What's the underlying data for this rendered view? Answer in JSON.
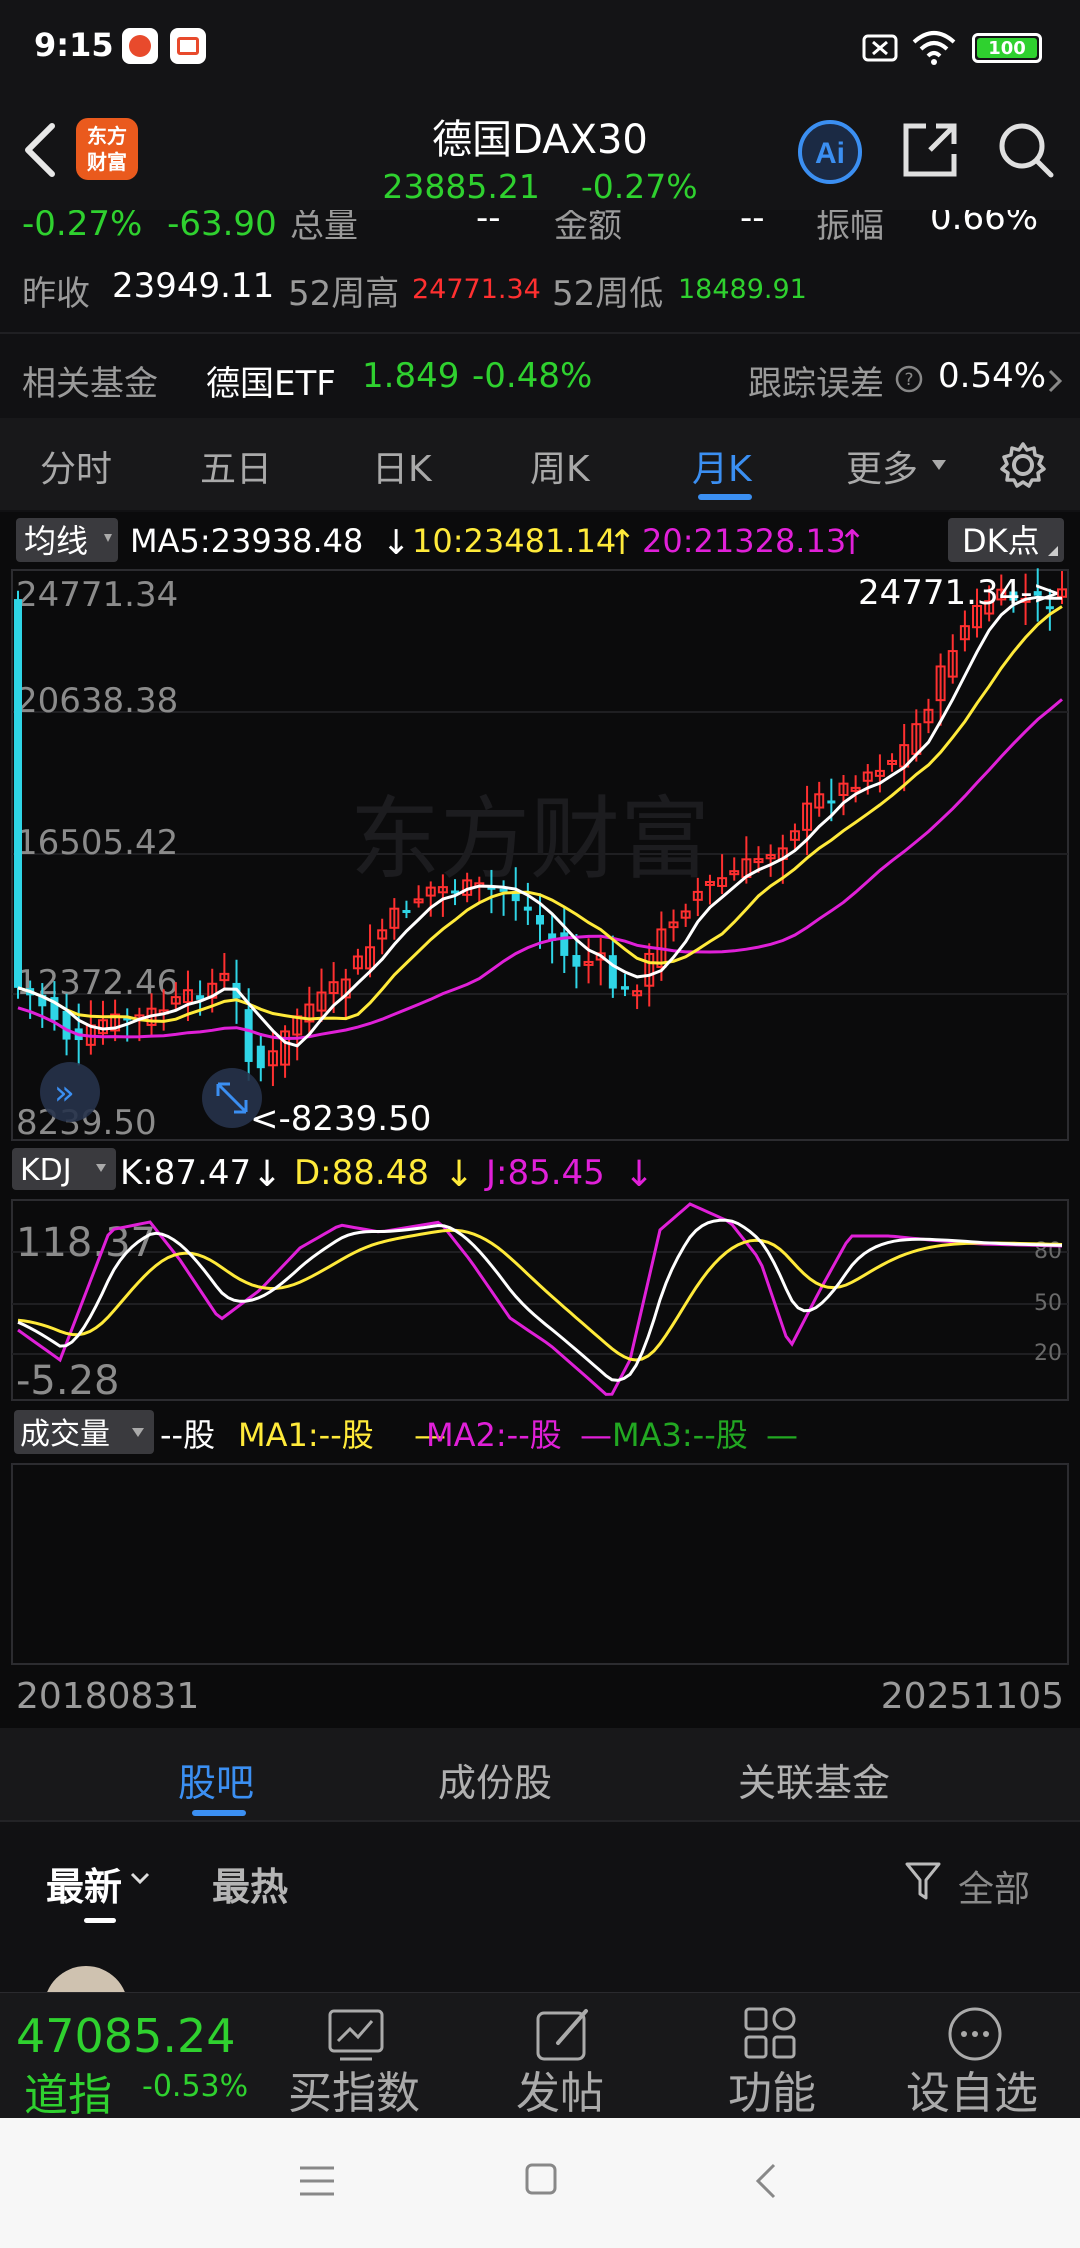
{
  "status": {
    "time": "9:15",
    "battery": "100"
  },
  "header": {
    "title": "德国DAX30",
    "price": "23885.21",
    "change_pct": "-0.27%",
    "logo_text_1": "东方",
    "logo_text_2": "财富"
  },
  "quote": {
    "change_pct": "-0.27%",
    "change_val": "-63.90",
    "volume_label": "总量",
    "volume_value": "--",
    "amount_label": "金额",
    "amount_value": "--",
    "amplitude_label": "振幅",
    "amplitude_value": "0.66%",
    "prev_close_label": "昨收",
    "prev_close": "23949.11",
    "high52_label": "52周高",
    "high52": "24771.34",
    "low52_label": "52周低",
    "low52": "18489.91"
  },
  "fund": {
    "label": "相关基金",
    "name": "德国ETF",
    "price": "1.849",
    "change": "-0.48%",
    "tracking_label": "跟踪误差",
    "tracking_value": "0.54%"
  },
  "kline_tabs": [
    "分时",
    "五日",
    "日K",
    "周K",
    "月K",
    "更多"
  ],
  "ma_bar": {
    "badge": "均线",
    "ma5": "MA5:23938.48",
    "ma10": "10:23481.14",
    "ma20": "20:21328.13",
    "dk": "DK点"
  },
  "main_chart": {
    "y_labels": [
      "24771.34",
      "20638.38",
      "16505.42",
      "12372.46",
      "8239.50"
    ],
    "max_marker": "24771.34->",
    "min_marker": "<-8239.50",
    "watermark": "东方财富"
  },
  "kdj": {
    "badge": "KDJ",
    "k": "K:87.47",
    "d": "D:88.48",
    "j": "J:85.45",
    "y_top": "118.37",
    "y_bottom": "-5.28",
    "levels": [
      "80",
      "50",
      "20"
    ]
  },
  "volume_panel": {
    "badge": "成交量",
    "value": "--股",
    "ma1": "MA1:--股",
    "ma2": "MA2:--股",
    "ma3": "MA3:--股"
  },
  "dates": {
    "start": "20180831",
    "end": "20251105"
  },
  "sub_tabs": [
    "股吧",
    "成份股",
    "关联基金"
  ],
  "feed_tabs": {
    "latest": "最新",
    "hot": "最热",
    "filter": "全部"
  },
  "bottom": {
    "index_value": "47085.24",
    "index_name": "道指",
    "index_change": "-0.53%",
    "tools": [
      "买指数",
      "发帖",
      "功能",
      "设自选"
    ]
  },
  "colors": {
    "accent": "#3b8ff2",
    "up": "#ff3030",
    "down": "#2fd12f",
    "ma5": "#ffffff",
    "ma10": "#ffea3a",
    "ma20": "#e020d8",
    "candle_down": "#2fd5e6"
  }
}
